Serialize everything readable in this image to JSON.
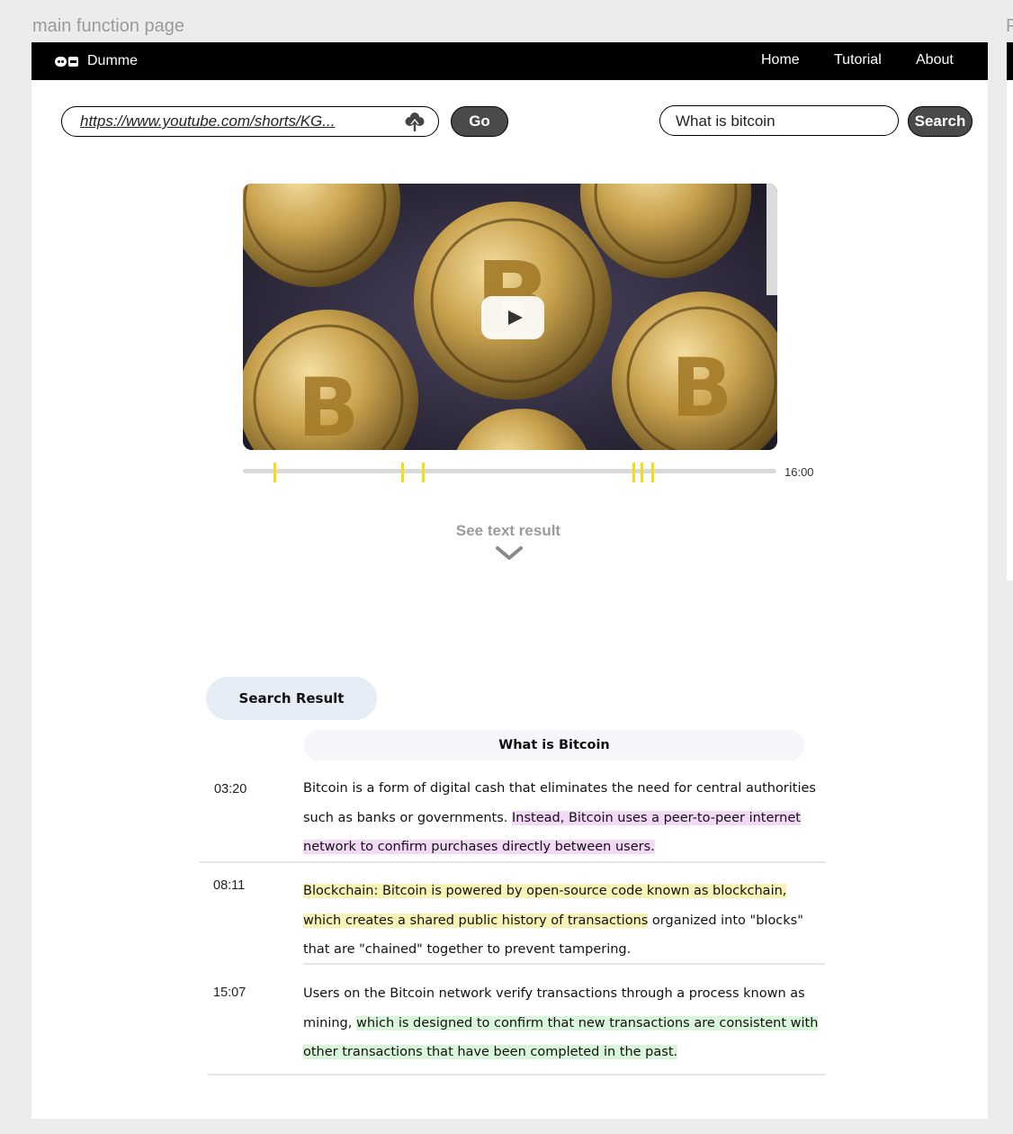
{
  "frame_label": "main function page",
  "frame_label_2": "P",
  "nav": {
    "brand": "Dumme",
    "links": [
      "Home",
      "Tutorial",
      "About"
    ]
  },
  "url_input": {
    "value": "https://www.youtube.com/shorts/KG..."
  },
  "go_label": "Go",
  "search": {
    "value": "What is bitcoin",
    "button": "Search"
  },
  "video": {
    "duration": "16:00"
  },
  "timeline": {
    "total_seconds": 960,
    "marker_seconds": [
      56,
      286,
      323,
      702,
      717,
      737
    ],
    "marker_color": "#f5dc1a"
  },
  "see_text_label": "See text result",
  "results": {
    "tab_label": "Search Result",
    "query": "What is Bitcoin",
    "items": [
      {
        "time": "03:20",
        "plain_before": "Bitcoin is a form of digital cash that eliminates the need for central authorities such as banks or governments. ",
        "highlight": "Instead, Bitcoin uses a peer-to-peer internet network to confirm purchases directly between users.",
        "plain_after": "",
        "highlight_color": "#f2d9f6"
      },
      {
        "time": "08:11",
        "plain_before": "",
        "highlight": "Blockchain: Bitcoin is powered by open-source code known as blockchain, which creates a shared public history of transactions",
        "plain_after": " organized into \"blocks\" that are \"chained\" together to prevent tampering.",
        "highlight_color": "#f8f2b6"
      },
      {
        "time": "15:07",
        "plain_before": "Users on the Bitcoin network verify transactions through a process known as mining, ",
        "highlight": "which is designed to confirm that new transactions are consistent with other transactions that have been completed in the past.",
        "plain_after": "",
        "highlight_color": "#daf6da"
      }
    ]
  },
  "colors": {
    "navbar": "#000000",
    "button": "#4a4a4a",
    "tab_bg": "#e7edf6",
    "page_bg": "#ececec"
  }
}
